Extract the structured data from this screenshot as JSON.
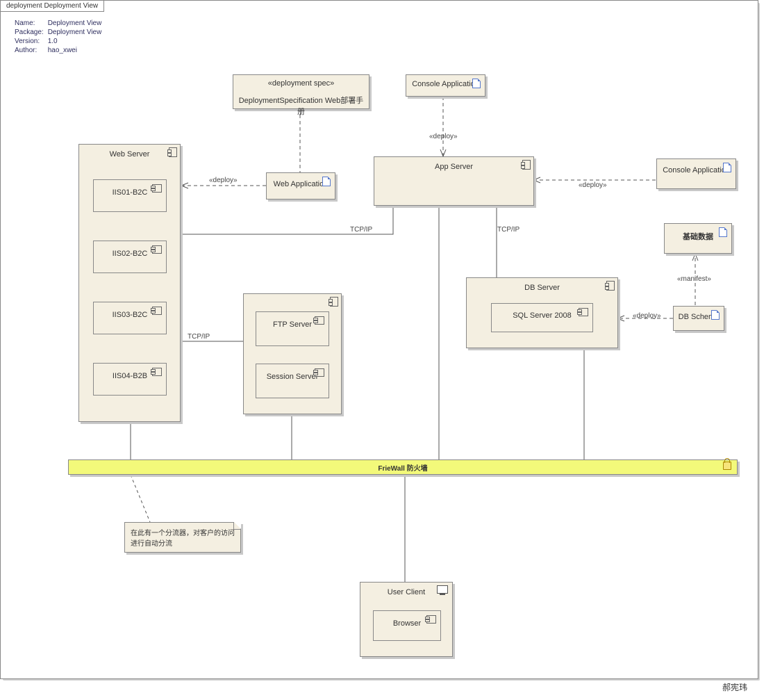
{
  "frame": {
    "title": "deployment Deployment View"
  },
  "meta": {
    "name_label": "Name:",
    "name_value": "Deployment View",
    "package_label": "Package:",
    "package_value": "Deployment View",
    "version_label": "Version:",
    "version_value": "1.0",
    "author_label": "Author:",
    "author_value": "hao_xwei"
  },
  "nodes": {
    "deploy_spec": {
      "stereo": "«deployment spec»",
      "name": "DeploymentSpecification Web部署手册"
    },
    "console_app_top": "Console Application",
    "console_app_right": "Console Application",
    "web_app": "Web Application",
    "db_schema": "DB Schema",
    "base_data": "基础数据",
    "web_server": {
      "title": "Web Server",
      "items": [
        "IIS01-B2C",
        "IIS02-B2C",
        "IIS03-B2C",
        "IIS04-B2B"
      ]
    },
    "app_server": {
      "title": "App Server"
    },
    "mid_server": {
      "items": [
        "FTP Server",
        "Session Server"
      ]
    },
    "db_server": {
      "title": "DB Server",
      "item": "SQL Server 2008"
    },
    "user_client": {
      "title": "User Client",
      "item": "Browser"
    }
  },
  "firewall": "FrieWall 防火墙",
  "note": "在此有一个分流器，对客户的访问进行自动分流",
  "labels": {
    "deploy1": "«deploy»",
    "deploy2": "«deploy»",
    "deploy3": "«deploy»",
    "deploy4": "«deploy»",
    "manifest": "«manifest»",
    "tcpip1": "TCP/IP",
    "tcpip2": "TCP/IP",
    "tcpip3": "TCP/IP"
  },
  "signature": "郝宪玮"
}
